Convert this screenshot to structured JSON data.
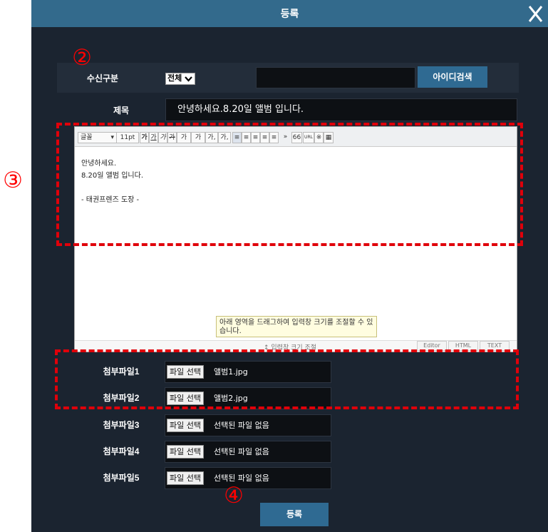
{
  "dialog": {
    "title": "등록",
    "close_label": "X"
  },
  "receiver": {
    "label": "수신구분",
    "selected": "전체",
    "id_value": "",
    "search_button": "아이디검색"
  },
  "subject": {
    "label": "제목",
    "value": "안녕하세요.8.20일 앨범 입니다."
  },
  "editor": {
    "toolbar": {
      "font_name": "글꼴",
      "font_size": "11pt",
      "items": [
        "가",
        "가",
        "가",
        "가",
        "가",
        "가",
        "가,",
        "가,",
        "≡",
        "≡",
        "≡",
        "≡",
        "≡",
        "»",
        "66",
        "URL",
        "※",
        "▦"
      ]
    },
    "body_lines": [
      "안녕하세요.",
      "8.20일 앨범 입니다.",
      "",
      "- 태권프렌즈 도장 -"
    ],
    "resize_tip": "아래 영역을 드래그하여 입력창 크기를 조절할 수 있습니다.",
    "resize_label": "↕ 입력창 크기 조절",
    "mode_tabs": [
      "Editor",
      "HTML",
      "TEXT"
    ]
  },
  "attachments": [
    {
      "label": "첨부파일1",
      "button": "파일 선택",
      "filename": "앨범1.jpg"
    },
    {
      "label": "첨부파일2",
      "button": "파일 선택",
      "filename": "앨범2.jpg"
    },
    {
      "label": "첨부파일3",
      "button": "파일 선택",
      "filename": "선택된 파일 없음"
    },
    {
      "label": "첨부파일4",
      "button": "파일 선택",
      "filename": "선택된 파일 없음"
    },
    {
      "label": "첨부파일5",
      "button": "파일 선택",
      "filename": "선택된 파일 없음"
    }
  ],
  "submit_button": "등록",
  "annotations": {
    "n2": "②",
    "n3": "③",
    "n4": "④"
  },
  "colors": {
    "titlebar": "#336a8c",
    "dialog_bg": "#1b2430",
    "button": "#2f6a92",
    "annotation_red": "#e0000a"
  }
}
